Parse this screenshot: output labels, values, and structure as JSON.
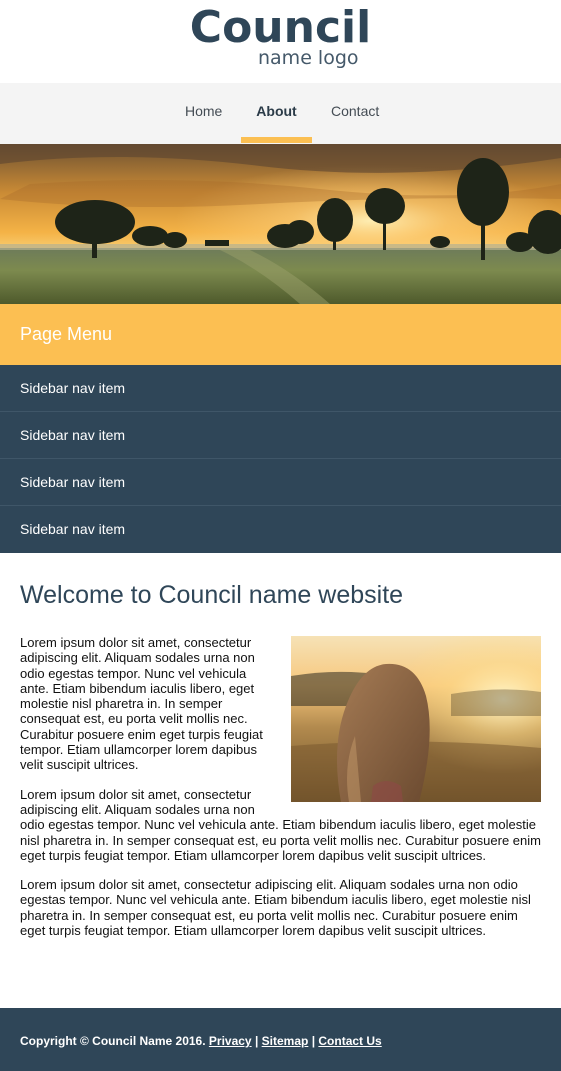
{
  "logo": {
    "main": "Council",
    "sub": "name logo"
  },
  "nav": {
    "items": [
      {
        "label": "Home"
      },
      {
        "label": "About"
      },
      {
        "label": "Contact"
      }
    ],
    "active": "About"
  },
  "colors": {
    "primary": "#2f4658",
    "accent": "#fcbf52",
    "nav_bg": "#f4f4f4"
  },
  "sidebar": {
    "heading": "Page Menu",
    "items": [
      {
        "label": "Sidebar nav item"
      },
      {
        "label": "Sidebar nav item"
      },
      {
        "label": "Sidebar nav item"
      },
      {
        "label": "Sidebar nav item"
      }
    ]
  },
  "main": {
    "title": "Welcome to Council name website",
    "paragraphs": [
      "Lorem ipsum dolor sit amet, consectetur adipiscing elit. Aliquam sodales urna non odio egestas tempor. Nunc vel vehicula ante. Etiam bibendum iaculis libero, eget molestie nisl pharetra in. In semper consequat est, eu porta velit mollis nec. Curabitur posuere enim eget turpis feugiat tempor. Etiam ullamcorper lorem dapibus velit suscipit ultrices.",
      "Lorem ipsum dolor sit amet, consectetur adipiscing elit. Aliquam sodales urna non odio egestas tempor. Nunc vel vehicula ante. Etiam bibendum iaculis libero, eget molestie nisl pharetra in. In semper consequat est, eu porta velit mollis nec. Curabitur posuere enim eget turpis feugiat tempor. Etiam ullamcorper lorem dapibus velit suscipit ultrices.",
      "Lorem ipsum dolor sit amet, consectetur adipiscing elit. Aliquam sodales urna non odio egestas tempor. Nunc vel vehicula ante. Etiam bibendum iaculis libero, eget molestie nisl pharetra in. In semper consequat est, eu porta velit mollis nec. Curabitur posuere enim eget turpis feugiat tempor. Etiam ullamcorper lorem dapibus velit suscipit ultrices."
    ]
  },
  "footer": {
    "copyright": "Copyright © Council Name 2016.",
    "separator": "|",
    "links": [
      {
        "label": "Privacy"
      },
      {
        "label": "Sitemap"
      },
      {
        "label": "Contact Us"
      }
    ]
  }
}
